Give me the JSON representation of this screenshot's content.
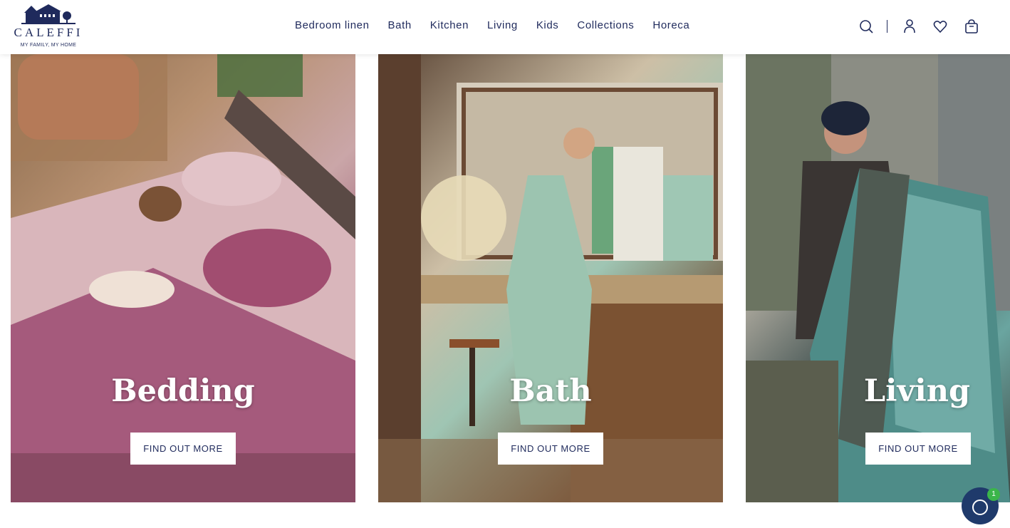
{
  "brand": {
    "name": "CALEFFI",
    "tagline": "MY FAMILY, MY HOME",
    "color": "#1f2a5c"
  },
  "nav": [
    "Bedroom linen",
    "Bath",
    "Kitchen",
    "Living",
    "Kids",
    "Collections",
    "Horeca"
  ],
  "header_icons": [
    "search-icon",
    "account-icon",
    "wishlist-heart-icon",
    "shopping-bag-icon"
  ],
  "panels": [
    {
      "title": "Bedding",
      "cta": "FIND OUT MORE"
    },
    {
      "title": "Bath",
      "cta": "FIND OUT MORE"
    },
    {
      "title": "Living",
      "cta": "FIND OUT MORE"
    }
  ],
  "chat": {
    "badge": "1",
    "color": "#1f3a6b",
    "badge_color": "#3bb54a"
  }
}
